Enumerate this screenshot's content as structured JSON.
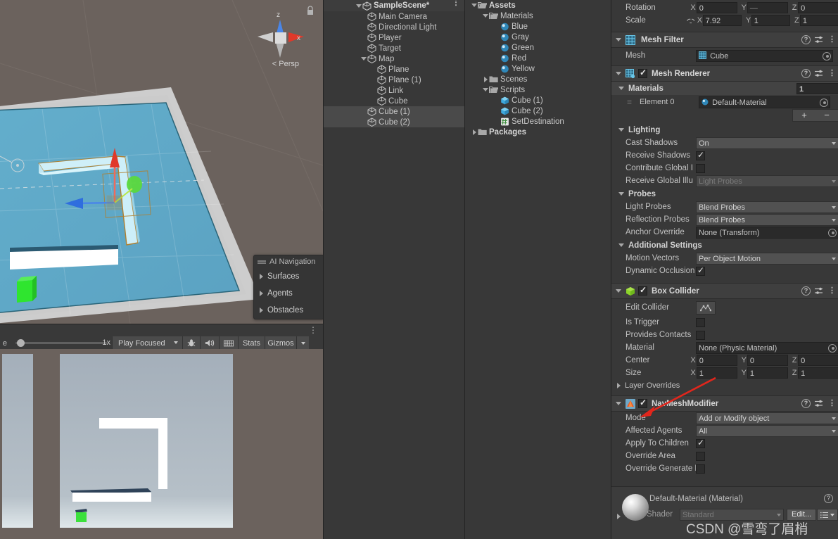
{
  "scene_view": {
    "gizmo": {
      "z_label": "z",
      "x_label": "x"
    },
    "persp_label": "< Persp",
    "lock_icon": "lock-icon",
    "ai_navigation": {
      "title": "AI Navigation",
      "items": [
        "Surfaces",
        "Agents",
        "Obstacles"
      ]
    }
  },
  "game_toolbar": {
    "scale_left_label": "e",
    "scale_value": "1x",
    "play_focused": "Play Focused",
    "mute_icon": "audio-icon",
    "bug_icon": "debug-icon",
    "grid_icon": "grid-icon",
    "stats": "Stats",
    "gizmos": "Gizmos",
    "kebab": "⋮"
  },
  "hierarchy": {
    "scene_name": "SampleScene*",
    "kebab": "⋮",
    "items": [
      {
        "label": "Main Camera",
        "depth": 2,
        "arrow": "",
        "selected": false
      },
      {
        "label": "Directional Light",
        "depth": 2,
        "arrow": "",
        "selected": false
      },
      {
        "label": "Player",
        "depth": 2,
        "arrow": "",
        "selected": false
      },
      {
        "label": "Target",
        "depth": 2,
        "arrow": "",
        "selected": false
      },
      {
        "label": "Map",
        "depth": 2,
        "arrow": "down",
        "selected": false
      },
      {
        "label": "Plane",
        "depth": 3,
        "arrow": "",
        "selected": false
      },
      {
        "label": "Plane (1)",
        "depth": 3,
        "arrow": "",
        "selected": false
      },
      {
        "label": "Link",
        "depth": 3,
        "arrow": "",
        "selected": false
      },
      {
        "label": "Cube",
        "depth": 3,
        "arrow": "",
        "selected": false
      },
      {
        "label": "Cube (1)",
        "depth": 2,
        "arrow": "",
        "selected": true
      },
      {
        "label": "Cube (2)",
        "depth": 2,
        "arrow": "",
        "selected": true
      }
    ]
  },
  "project": {
    "items": [
      {
        "label": "Assets",
        "depth": 0,
        "arrow": "down",
        "icon": "folder-open",
        "bold": true
      },
      {
        "label": "Materials",
        "depth": 1,
        "arrow": "down",
        "icon": "folder-open",
        "bold": false
      },
      {
        "label": "Blue",
        "depth": 2,
        "arrow": "",
        "icon": "material",
        "bold": false
      },
      {
        "label": "Gray",
        "depth": 2,
        "arrow": "",
        "icon": "material",
        "bold": false
      },
      {
        "label": "Green",
        "depth": 2,
        "arrow": "",
        "icon": "material",
        "bold": false
      },
      {
        "label": "Red",
        "depth": 2,
        "arrow": "",
        "icon": "material",
        "bold": false
      },
      {
        "label": "Yellow",
        "depth": 2,
        "arrow": "",
        "icon": "material",
        "bold": false
      },
      {
        "label": "Scenes",
        "depth": 1,
        "arrow": "right",
        "icon": "folder",
        "bold": false
      },
      {
        "label": "Scripts",
        "depth": 1,
        "arrow": "down",
        "icon": "folder-open",
        "bold": false
      },
      {
        "label": "Cube (1)",
        "depth": 2,
        "arrow": "",
        "icon": "prefab",
        "bold": false
      },
      {
        "label": "Cube (2)",
        "depth": 2,
        "arrow": "",
        "icon": "prefab",
        "bold": false
      },
      {
        "label": "SetDestination",
        "depth": 2,
        "arrow": "",
        "icon": "script",
        "bold": false
      },
      {
        "label": "Packages",
        "depth": 0,
        "arrow": "right",
        "icon": "folder",
        "bold": true
      }
    ]
  },
  "inspector": {
    "transform": {
      "rotation_label": "Rotation",
      "rotation": {
        "x": "0",
        "y": "—",
        "z": "0"
      },
      "scale_label": "Scale",
      "scale": {
        "x": "7.92",
        "y": "1",
        "z": "1"
      },
      "link_icon": "broken-link-icon"
    },
    "mesh_filter": {
      "title": "Mesh Filter",
      "mesh_label": "Mesh",
      "mesh_value": "Cube",
      "icon": "mesh-filter-icon"
    },
    "mesh_renderer": {
      "title": "Mesh Renderer",
      "enabled": true,
      "icon": "mesh-renderer-icon",
      "materials_label": "Materials",
      "materials_count": "1",
      "element_label": "Element 0",
      "element_value": "Default-Material",
      "add_btn": "+",
      "remove_btn": "−",
      "lighting_label": "Lighting",
      "cast_shadows_label": "Cast Shadows",
      "cast_shadows_value": "On",
      "receive_shadows_label": "Receive Shadows",
      "receive_shadows_checked": true,
      "contribute_gi_label": "Contribute Global I",
      "contribute_gi_checked": false,
      "receive_gi_label": "Receive Global Illu",
      "receive_gi_value": "Light Probes",
      "probes_label": "Probes",
      "light_probes_label": "Light Probes",
      "light_probes_value": "Blend Probes",
      "reflection_probes_label": "Reflection Probes",
      "reflection_probes_value": "Blend Probes",
      "anchor_override_label": "Anchor Override",
      "anchor_override_value": "None (Transform)",
      "additional_settings_label": "Additional Settings",
      "motion_vectors_label": "Motion Vectors",
      "motion_vectors_value": "Per Object Motion",
      "dynamic_occlusion_label": "Dynamic Occlusion",
      "dynamic_occlusion_checked": true
    },
    "box_collider": {
      "title": "Box Collider",
      "enabled": true,
      "icon": "box-collider-icon",
      "edit_collider_label": "Edit Collider",
      "is_trigger_label": "Is Trigger",
      "is_trigger_checked": false,
      "provides_contacts_label": "Provides Contacts",
      "provides_contacts_checked": false,
      "material_label": "Material",
      "material_value": "None (Physic Material)",
      "center_label": "Center",
      "center": {
        "x": "0",
        "y": "0",
        "z": "0"
      },
      "size_label": "Size",
      "size": {
        "x": "1",
        "y": "1",
        "z": "1"
      },
      "layer_overrides_label": "Layer Overrides"
    },
    "navmesh_modifier": {
      "title": "NavMeshModifier",
      "enabled": true,
      "icon": "navmesh-modifier-icon",
      "mode_label": "Mode",
      "mode_value": "Add or Modify object",
      "affected_agents_label": "Affected Agents",
      "affected_agents_value": "All",
      "apply_to_children_label": "Apply To Children",
      "apply_to_children_checked": true,
      "override_area_label": "Override Area",
      "override_area_checked": false,
      "override_generate_links_label": "Override Generate Lir",
      "override_generate_links_checked": false
    },
    "material_preview": {
      "title": "Default-Material (Material)",
      "shader_label": "Shader",
      "shader_value": "Standard",
      "edit_button": "Edit...",
      "preset_icon": "preset-icon"
    }
  },
  "watermark": "CSDN @雪弯了眉梢",
  "colors": {
    "panel_bg": "#383838",
    "header_bg": "#3f3f3f",
    "field_bg": "#2a2a2a",
    "popup_bg": "#515151",
    "scene_bg": "#6b625d",
    "plane_blue": "#5fa8c8",
    "accent_green": "#3ce03c",
    "axis_red": "#e8452f",
    "axis_blue": "#3d7fe8",
    "selection": "#4a4a4a",
    "annotation_red": "#e1261c"
  }
}
